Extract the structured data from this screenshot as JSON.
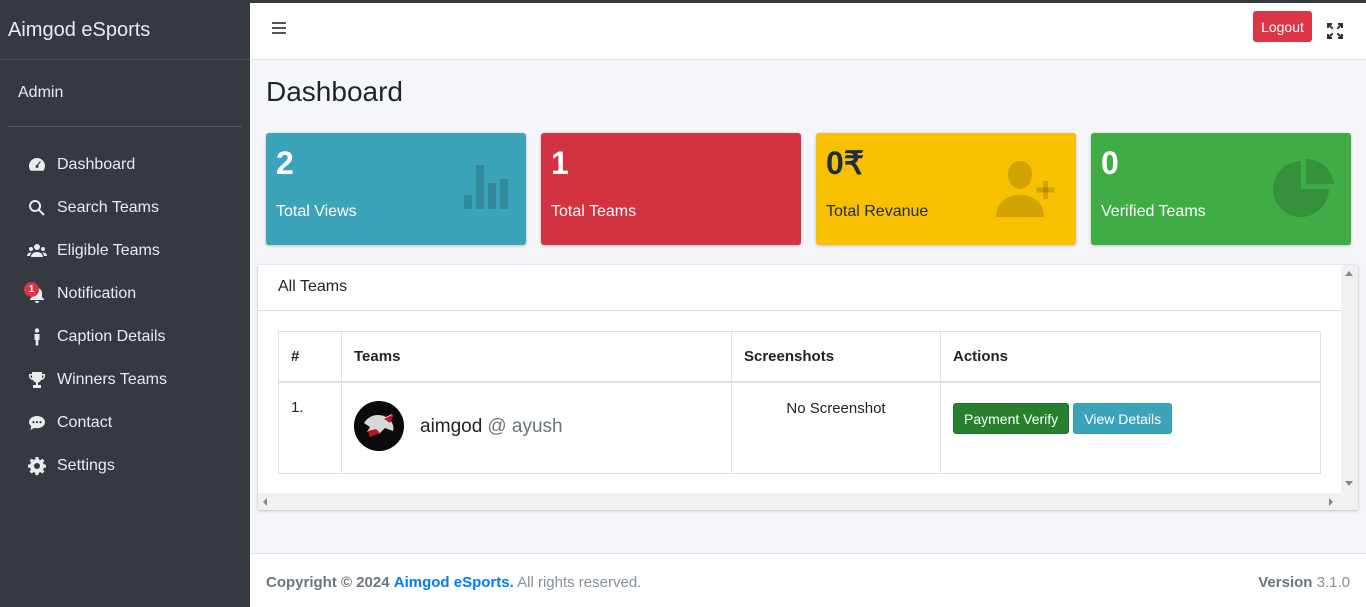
{
  "brand": "Aimgod eSports",
  "user": "Admin",
  "sidebar": {
    "items": [
      {
        "label": "Dashboard",
        "icon": "dashboard-icon"
      },
      {
        "label": "Search Teams",
        "icon": "search-icon"
      },
      {
        "label": "Eligible Teams",
        "icon": "users-icon"
      },
      {
        "label": "Notification",
        "icon": "bell-icon",
        "badge": "1"
      },
      {
        "label": "Caption Details",
        "icon": "person-icon"
      },
      {
        "label": "Winners Teams",
        "icon": "trophy-icon"
      },
      {
        "label": "Contact",
        "icon": "chat-icon"
      },
      {
        "label": "Settings",
        "icon": "gear-icon"
      }
    ]
  },
  "header": {
    "logout_label": "Logout"
  },
  "page_title": "Dashboard",
  "stats": [
    {
      "value": "2",
      "label": "Total Views",
      "color": "#3ba3ba",
      "icon": "bar-chart-icon"
    },
    {
      "value": "1",
      "label": "Total Teams",
      "color": "#d33240"
    },
    {
      "value": "0₹",
      "label": "Total Revanue",
      "color": "#f7c000",
      "icon": "user-plus-icon"
    },
    {
      "value": "0",
      "label": "Verified Teams",
      "color": "#3fac45",
      "icon": "pie-chart-icon"
    }
  ],
  "teams_card": {
    "title": "All Teams",
    "columns": [
      "#",
      "Teams",
      "Screenshots",
      "Actions"
    ],
    "rows": [
      {
        "index": "1.",
        "team": "aimgod",
        "owner": "@ ayush",
        "screenshot": "No Screenshot",
        "verify_label": "Payment Verify",
        "details_label": "View Details"
      }
    ]
  },
  "footer": {
    "copyright": "Copyright © 2024",
    "link": "Aimgod eSports.",
    "rights": "All rights reserved.",
    "version_label": "Version",
    "version": "3.1.0"
  }
}
